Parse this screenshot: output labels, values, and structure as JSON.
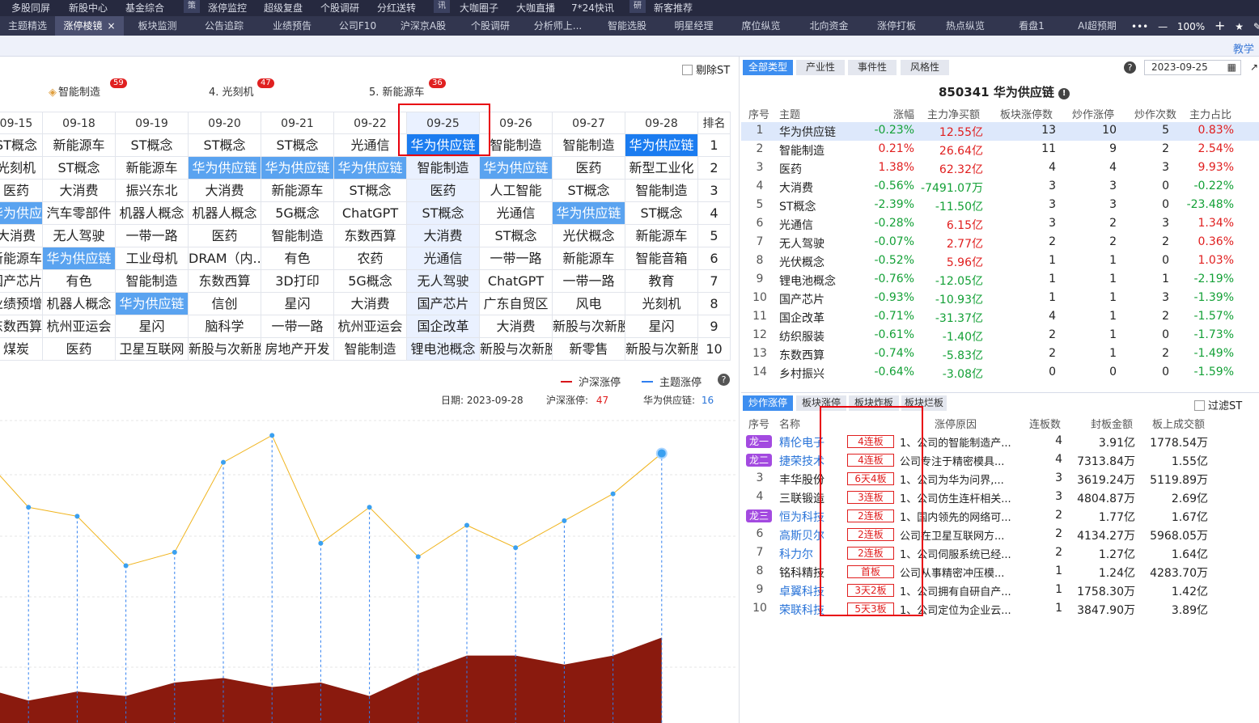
{
  "top_nav": [
    "多股同屏",
    "新股中心",
    "基金综合",
    "策",
    "涨停监控",
    "超级复盘",
    "个股调研",
    "分红送转",
    "讯",
    "大咖圈子",
    "大咖直播",
    "7*24快讯",
    "研",
    "新客推荐"
  ],
  "tabs": [
    {
      "label": "主题精选",
      "active": false
    },
    {
      "label": "涨停棱镜",
      "active": true
    },
    {
      "label": "板块监测",
      "active": false
    },
    {
      "label": "公告追踪",
      "active": false
    },
    {
      "label": "业绩预告",
      "active": false
    },
    {
      "label": "公司F10",
      "active": false
    },
    {
      "label": "沪深京A股",
      "active": false
    },
    {
      "label": "个股调研",
      "active": false
    },
    {
      "label": "分析师上...",
      "active": false
    },
    {
      "label": "智能选股",
      "active": false
    },
    {
      "label": "明星经理",
      "active": false
    },
    {
      "label": "席位纵览",
      "active": false
    },
    {
      "label": "北向资金",
      "active": false
    },
    {
      "label": "涨停打板",
      "active": false
    },
    {
      "label": "热点纵览",
      "active": false
    },
    {
      "label": "看盘1",
      "active": false
    },
    {
      "label": "AI超预期",
      "active": false
    }
  ],
  "tab_close": "×",
  "window_controls": {
    "more": "•••",
    "minus": "—",
    "zoom": "100%",
    "plus": "+"
  },
  "help_link": "教学",
  "filter_st": "剔除ST",
  "top_themes": [
    {
      "label": "智能制造",
      "badge": "59"
    },
    {
      "label": "4. 光刻机",
      "badge": "47"
    },
    {
      "label": "5. 新能源车",
      "badge": "36"
    }
  ],
  "grid": {
    "dates": [
      "09-15",
      "09-18",
      "09-19",
      "09-20",
      "09-21",
      "09-22",
      "09-25",
      "09-26",
      "09-27",
      "09-28"
    ],
    "rank_label": "排名",
    "ranks": [
      "1",
      "2",
      "3",
      "4",
      "5",
      "6",
      "7",
      "8",
      "9",
      "10"
    ],
    "rows": [
      [
        "ST概念",
        "新能源车",
        "ST概念",
        "ST概念",
        "ST概念",
        "光通信",
        "华为供应链",
        "智能制造",
        "智能制造",
        "华为供应链"
      ],
      [
        "光刻机",
        "ST概念",
        "新能源车",
        "华为供应链",
        "华为供应链",
        "华为供应链",
        "智能制造",
        "华为供应链",
        "医药",
        "新型工业化"
      ],
      [
        "医药",
        "大消费",
        "振兴东北",
        "大消费",
        "新能源车",
        "ST概念",
        "医药",
        "人工智能",
        "ST概念",
        "智能制造"
      ],
      [
        "华为供应链",
        "汽车零部件",
        "机器人概念",
        "机器人概念",
        "5G概念",
        "ChatGPT",
        "ST概念",
        "光通信",
        "华为供应链",
        "ST概念"
      ],
      [
        "大消费",
        "无人驾驶",
        "一带一路",
        "医药",
        "智能制造",
        "东数西算",
        "大消费",
        "ST概念",
        "光伏概念",
        "新能源车"
      ],
      [
        "新能源车",
        "华为供应链",
        "工业母机",
        "DRAM（内...",
        "有色",
        "农药",
        "光通信",
        "一带一路",
        "新能源车",
        "智能音箱"
      ],
      [
        "国产芯片",
        "有色",
        "智能制造",
        "东数西算",
        "3D打印",
        "5G概念",
        "无人驾驶",
        "ChatGPT",
        "一带一路",
        "教育"
      ],
      [
        "业绩预增",
        "机器人概念",
        "华为供应链",
        "信创",
        "星闪",
        "大消费",
        "国产芯片",
        "广东自贸区",
        "风电",
        "光刻机"
      ],
      [
        "东数西算",
        "杭州亚运会",
        "星闪",
        "脑科学",
        "一带一路",
        "杭州亚运会",
        "国企改革",
        "大消费",
        "新股与次新股",
        "星闪"
      ],
      [
        "煤炭",
        "医药",
        "卫星互联网",
        "新股与次新股",
        "房地产开发",
        "智能制造",
        "锂电池概念",
        "新股与次新股",
        "新零售",
        "新股与次新股"
      ]
    ]
  },
  "legend": {
    "a": "沪深涨停",
    "b": "主题涨停",
    "colors": {
      "a": "#d8161a",
      "b": "#2f7ff0"
    }
  },
  "info": {
    "date_label": "日期:",
    "date": "2023-09-28",
    "hs_label": "沪深涨停:",
    "hs": "47",
    "theme_label": "华为供应链:",
    "theme": "16"
  },
  "line_series": [
    60,
    48,
    46,
    35,
    38,
    58,
    64,
    40,
    48,
    37,
    44,
    39,
    45,
    51,
    60
  ],
  "area_series": [
    8,
    5,
    7,
    6,
    9,
    10,
    8,
    9,
    6,
    11,
    15,
    15,
    13,
    15,
    19
  ],
  "right": {
    "filter_tabs": [
      "全部类型",
      "产业性",
      "事件性",
      "风格性"
    ],
    "date": "2023-09-25",
    "title": "850341 华为供应链",
    "headers": [
      "序号",
      "主题",
      "涨幅",
      "主力净买额",
      "板块涨停数",
      "炒作涨停",
      "炒作次数",
      "主力占比"
    ],
    "rows": [
      [
        "1",
        "华为供应链",
        "-0.23%",
        "12.55亿",
        "13",
        "10",
        "5",
        "0.83%"
      ],
      [
        "2",
        "智能制造",
        "0.21%",
        "26.64亿",
        "11",
        "9",
        "2",
        "2.54%"
      ],
      [
        "3",
        "医药",
        "1.38%",
        "62.32亿",
        "4",
        "4",
        "3",
        "9.93%"
      ],
      [
        "4",
        "大消费",
        "-0.56%",
        "-7491.07万",
        "3",
        "3",
        "0",
        "-0.22%"
      ],
      [
        "5",
        "ST概念",
        "-2.39%",
        "-11.50亿",
        "3",
        "3",
        "0",
        "-23.48%"
      ],
      [
        "6",
        "光通信",
        "-0.28%",
        "6.15亿",
        "3",
        "2",
        "3",
        "1.34%"
      ],
      [
        "7",
        "无人驾驶",
        "-0.07%",
        "2.77亿",
        "2",
        "2",
        "2",
        "0.36%"
      ],
      [
        "8",
        "光伏概念",
        "-0.52%",
        "5.96亿",
        "1",
        "1",
        "0",
        "1.03%"
      ],
      [
        "9",
        "锂电池概念",
        "-0.76%",
        "-12.05亿",
        "1",
        "1",
        "1",
        "-2.19%"
      ],
      [
        "10",
        "国产芯片",
        "-0.93%",
        "-10.93亿",
        "1",
        "1",
        "3",
        "-1.39%"
      ],
      [
        "11",
        "国企改革",
        "-0.71%",
        "-31.37亿",
        "4",
        "1",
        "2",
        "-1.57%"
      ],
      [
        "12",
        "纺织服装",
        "-0.61%",
        "-1.40亿",
        "2",
        "1",
        "0",
        "-1.73%"
      ],
      [
        "13",
        "东数西算",
        "-0.74%",
        "-5.83亿",
        "2",
        "1",
        "2",
        "-1.49%"
      ],
      [
        "14",
        "乡村振兴",
        "-0.64%",
        "-3.08亿",
        "0",
        "0",
        "0",
        "-1.59%"
      ]
    ],
    "bottom_tabs": [
      "炒作涨停",
      "板块涨停",
      "板块炸板",
      "板块烂板"
    ],
    "filter_st2": "过滤ST",
    "lb_headers": [
      "序号",
      "名称",
      "涨停原因",
      "连板数",
      "封板金额",
      "板上成交额"
    ],
    "lb_rows": [
      {
        "idx": "龙一",
        "name": "精伦电子",
        "tag": "4连板",
        "reason": "1、公司的智能制造产...",
        "lb": "4",
        "fb": "3.91亿",
        "cj": "1778.54万",
        "dragon": true,
        "blue": true
      },
      {
        "idx": "龙二",
        "name": "捷荣技术",
        "tag": "4连板",
        "reason": "公司专注于精密模具...",
        "lb": "4",
        "fb": "7313.84万",
        "cj": "1.55亿",
        "dragon": true,
        "blue": true
      },
      {
        "idx": "3",
        "name": "丰华股份",
        "tag": "6天4板",
        "reason": "1、公司为华为问界,...",
        "lb": "3",
        "fb": "3619.24万",
        "cj": "5119.89万",
        "dragon": false,
        "blue": false
      },
      {
        "idx": "4",
        "name": "三联锻造",
        "tag": "3连板",
        "reason": "1、公司仿生连杆相关...",
        "lb": "3",
        "fb": "4804.87万",
        "cj": "2.69亿",
        "dragon": false,
        "blue": false
      },
      {
        "idx": "龙三",
        "name": "恒为科技",
        "tag": "2连板",
        "reason": "1、国内领先的网络可...",
        "lb": "2",
        "fb": "1.77亿",
        "cj": "1.67亿",
        "dragon": true,
        "blue": true
      },
      {
        "idx": "6",
        "name": "高斯贝尔",
        "tag": "2连板",
        "reason": "公司在卫星互联网方...",
        "lb": "2",
        "fb": "4134.27万",
        "cj": "5968.05万",
        "dragon": false,
        "blue": true
      },
      {
        "idx": "7",
        "name": "科力尔",
        "tag": "2连板",
        "reason": "1、公司伺服系统已经...",
        "lb": "2",
        "fb": "1.27亿",
        "cj": "1.64亿",
        "dragon": false,
        "blue": true
      },
      {
        "idx": "8",
        "name": "铭科精技",
        "tag": "首板",
        "reason": "公司从事精密冲压模...",
        "lb": "1",
        "fb": "1.24亿",
        "cj": "4283.70万",
        "dragon": false,
        "blue": false
      },
      {
        "idx": "9",
        "name": "卓翼科技",
        "tag": "3天2板",
        "reason": "1、公司拥有自研自产...",
        "lb": "1",
        "fb": "1758.30万",
        "cj": "1.42亿",
        "dragon": false,
        "blue": true
      },
      {
        "idx": "10",
        "name": "荣联科技",
        "tag": "5天3板",
        "reason": "1、公司定位为企业云...",
        "lb": "1",
        "fb": "3847.90万",
        "cj": "3.89亿",
        "dragon": false,
        "blue": true
      }
    ]
  }
}
